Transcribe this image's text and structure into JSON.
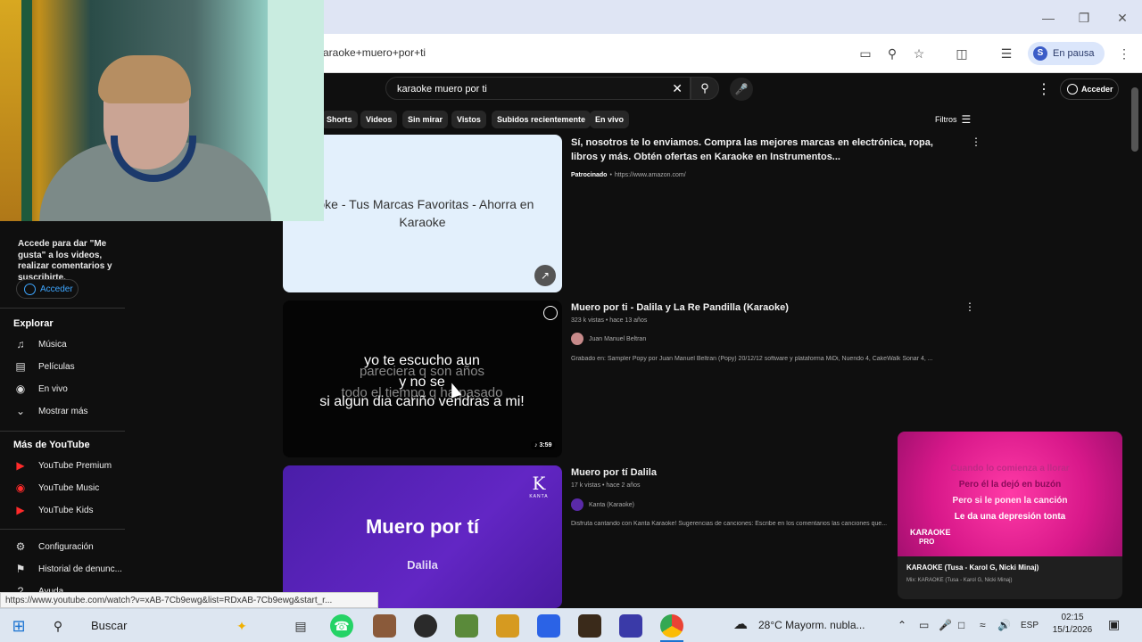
{
  "browser": {
    "address_text": "araoke+muero+por+ti",
    "profile_label": "En pausa",
    "profile_initial": "S",
    "status_url": "https://www.youtube.com/watch?v=xAB-7Cb9ewg&list=RDxAB-7Cb9ewg&start_r..."
  },
  "youtube": {
    "search_value": "karaoke muero por ti",
    "login_top": "Acceder",
    "chips": [
      "Shorts",
      "Videos",
      "Sin mirar",
      "Vistos",
      "Subidos recientemente",
      "En vivo"
    ],
    "filters_label": "Filtros",
    "sidebar": {
      "login_prompt": "Accede para dar \"Me gusta\" a los videos, realizar comentarios y suscribirte.",
      "login_button": "Acceder",
      "explore_header": "Explorar",
      "explore_items": [
        "Música",
        "Películas",
        "En vivo",
        "Mostrar más"
      ],
      "more_header": "Más de YouTube",
      "more_items": [
        "YouTube Premium",
        "YouTube Music",
        "YouTube Kids"
      ],
      "settings_items": [
        "Configuración",
        "Historial de denunc...",
        "Ayuda"
      ]
    },
    "results": [
      {
        "thumb_text": "aoke - Tus Marcas Favoritas - Ahorra en Karaoke",
        "title": "Sí, nosotros te lo enviamos. Compra las mejores marcas en electrónica, ropa, libros y más. Obtén ofertas en Karaoke en Instrumentos...",
        "sponsored": "Patrocinado",
        "sponsored_url": "https://www.amazon.com/"
      },
      {
        "title": "Muero por ti - Dalila y La Re Pandilla (Karaoke)",
        "meta": "323 k vistas • hace 13 años",
        "channel": "Juan Manuel Beltran",
        "desc": "Grabado en: Sampler Popy por Juan Manuel Beltran (Popy) 20/12/12 software y plataforma MiDi, Nuendo 4, CakeWalk Sonar 4, ...",
        "lyrics": [
          "yo te escucho aun",
          "pareciera q son años",
          "y no se",
          "todo el tiempo q ha pasado",
          "si algun dia cariño vendras a mi!"
        ],
        "duration": "3:59"
      },
      {
        "title": "Muero por tí Dalila",
        "meta": "17 k vistas • hace 2 años",
        "channel": "Kanta (Karaoke)",
        "desc": "Disfruta cantando con Kanta Karaoke! Sugerencias de canciones: Escribe en los comentarios las canciones que...",
        "thumb_title": "Muero por tí",
        "thumb_sub": "Dalila",
        "thumb_logo": "K",
        "thumb_logo_sub": "KANTA"
      }
    ],
    "miniplayer": {
      "lines": [
        "Cuando lo comienza a llorar",
        "Pero él la dejó en buzón",
        "Pero si le ponen la canción",
        "Le da una depresión tonta"
      ],
      "brand": "KARAOKE",
      "brand_sub": "PRO",
      "title": "KARAOKE (Tusa - Karol G, Nicki Minaj)",
      "subtitle": "Mix: KARAOKE (Tusa - Karol G, Nicki Minaj)"
    }
  },
  "taskbar": {
    "search_label": "Buscar",
    "weather": "28°C  Mayorm. nubla...",
    "lang": "ESP",
    "time": "02:15",
    "date": "15/1/2026"
  }
}
